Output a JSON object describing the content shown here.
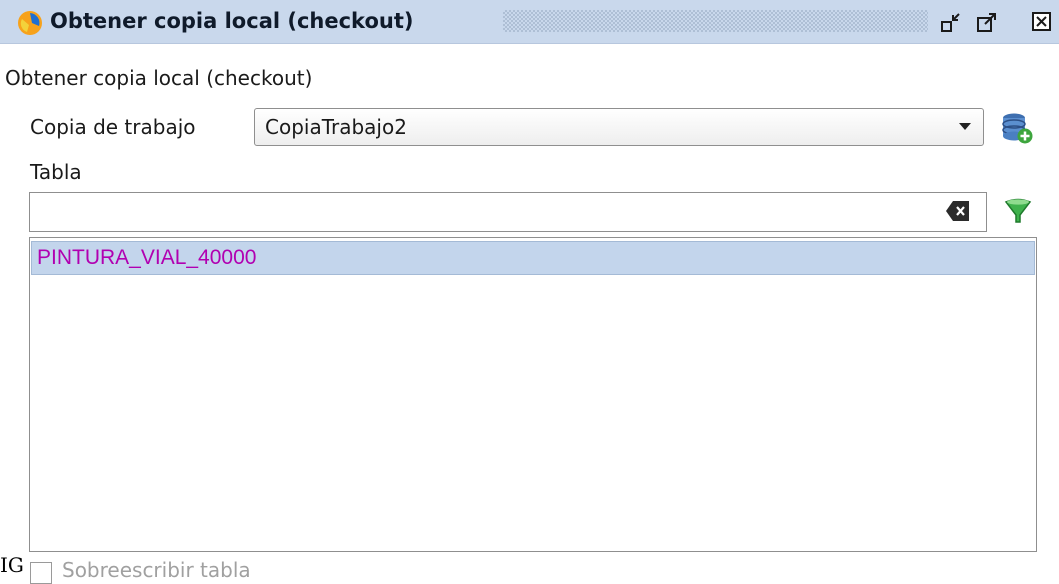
{
  "window": {
    "title": "Obtener copia local (checkout)",
    "minimize_icon": "minimize-icon",
    "maximize_icon": "maximize-icon",
    "close_icon": "close-icon"
  },
  "panel": {
    "heading": "Obtener copia local (checkout)",
    "working_copy": {
      "label": "Copia de trabajo",
      "selected_value": "CopiaTrabajo2",
      "add_icon": "database-add-icon"
    },
    "table": {
      "label": "Tabla",
      "filter_value": "",
      "clear_icon": "clear-input-icon",
      "filter_icon": "filter-funnel-icon",
      "items": [
        "PINTURA_VIAL_40000"
      ]
    },
    "overwrite": {
      "label": "Sobreescribir tabla",
      "checked": false
    },
    "stray_text": "IG"
  },
  "colors": {
    "titlebar_bg": "#c9d8ec",
    "selection_bg": "#c3d5ec",
    "item_text": "#b100b1"
  }
}
